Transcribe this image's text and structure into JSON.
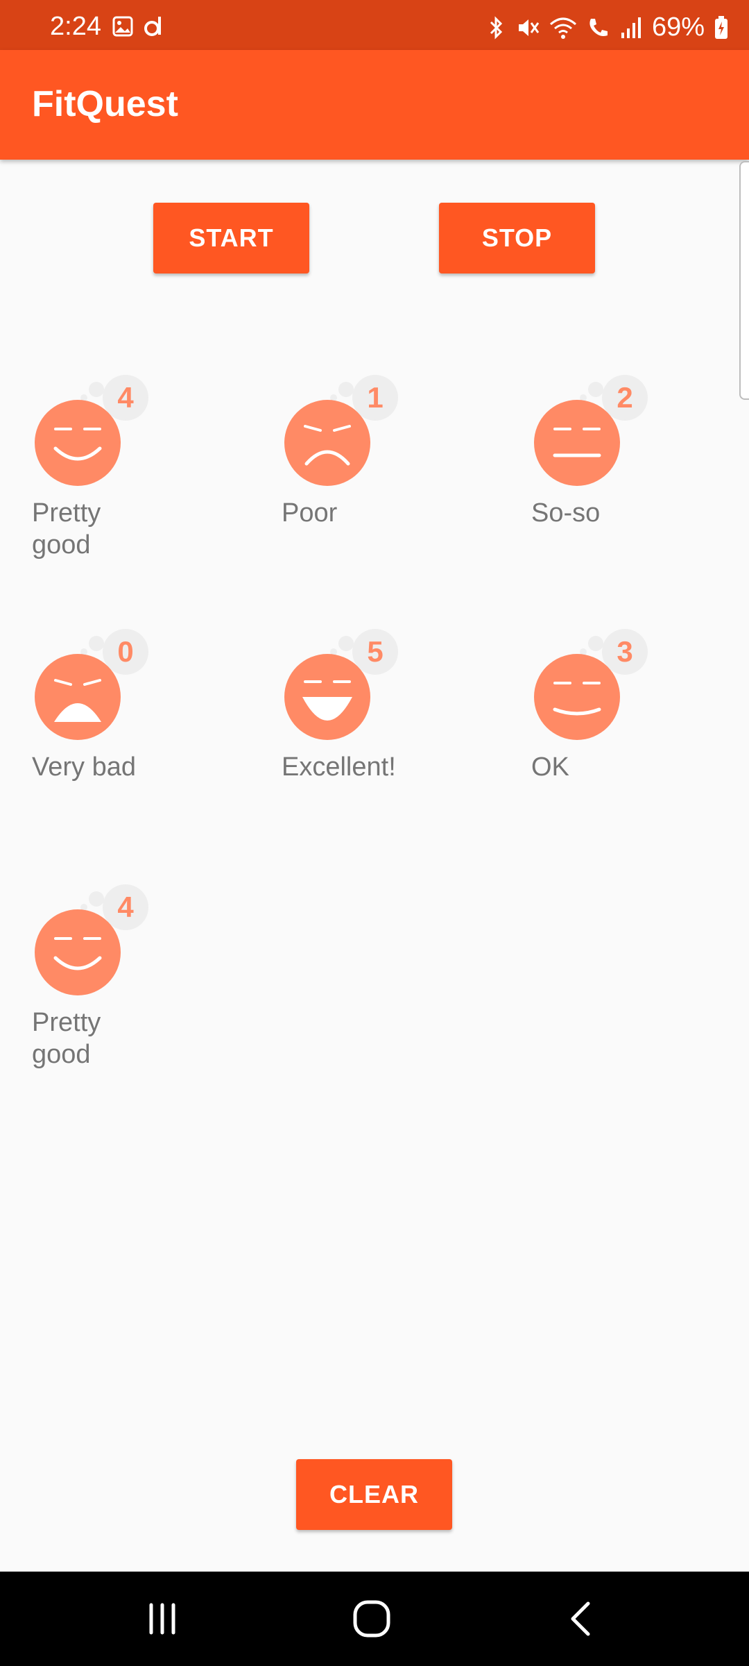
{
  "status_bar": {
    "time": "2:24",
    "battery": "69%"
  },
  "app_bar": {
    "title": "FitQuest"
  },
  "buttons": {
    "start": "START",
    "stop": "STOP",
    "clear": "CLEAR"
  },
  "colors": {
    "status_bar": "#d84315",
    "accent": "#ff5722",
    "face": "#ff8a65",
    "bubble": "#eeeeee"
  },
  "moods": [
    {
      "label": "Pretty good",
      "count": "4",
      "face": "smile"
    },
    {
      "label": "Poor",
      "count": "1",
      "face": "frown"
    },
    {
      "label": "So-so",
      "count": "2",
      "face": "neutral"
    },
    {
      "label": "Very bad",
      "count": "0",
      "face": "crying"
    },
    {
      "label": "Excellent!",
      "count": "5",
      "face": "big-smile"
    },
    {
      "label": "OK",
      "count": "3",
      "face": "slight-smile"
    },
    {
      "label": "Pretty good",
      "count": "4",
      "face": "smile"
    }
  ]
}
